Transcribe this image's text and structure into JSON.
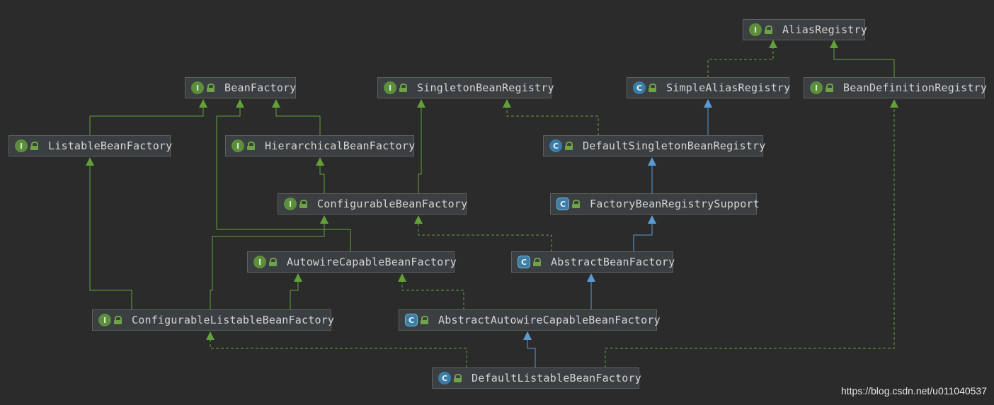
{
  "colors": {
    "background": "#2b2b2b",
    "node_fill": "#3c3f41",
    "extends_interface": "#62a03a",
    "implements_interface": "#62a03a",
    "extends_class": "#5b9bd5"
  },
  "nodes": {
    "alias_registry": {
      "label": "AliasRegistry",
      "kind": "I"
    },
    "bean_factory": {
      "label": "BeanFactory",
      "kind": "I"
    },
    "singleton_bean_registry": {
      "label": "SingletonBeanRegistry",
      "kind": "I"
    },
    "simple_alias_registry": {
      "label": "SimpleAliasRegistry",
      "kind": "C"
    },
    "bean_definition_registry": {
      "label": "BeanDefinitionRegistry",
      "kind": "I"
    },
    "listable_bean_factory": {
      "label": "ListableBeanFactory",
      "kind": "I"
    },
    "hierarchical_bean_factory": {
      "label": "HierarchicalBeanFactory",
      "kind": "I"
    },
    "default_singleton_bean_registry": {
      "label": "DefaultSingletonBeanRegistry",
      "kind": "C"
    },
    "configurable_bean_factory": {
      "label": "ConfigurableBeanFactory",
      "kind": "I"
    },
    "factory_bean_registry_support": {
      "label": "FactoryBeanRegistrySupport",
      "kind": "C"
    },
    "autowire_capable_bean_factory": {
      "label": "AutowireCapableBeanFactory",
      "kind": "I"
    },
    "abstract_bean_factory": {
      "label": "AbstractBeanFactory",
      "kind": "C"
    },
    "configurable_listable_bean_factory": {
      "label": "ConfigurableListableBeanFactory",
      "kind": "I"
    },
    "abstract_autowire_capable_bean_factory": {
      "label": "AbstractAutowireCapableBeanFactory",
      "kind": "C"
    },
    "default_listable_bean_factory": {
      "label": "DefaultListableBeanFactory",
      "kind": "C"
    }
  },
  "watermark": "https://blog.csdn.net/u011040537"
}
